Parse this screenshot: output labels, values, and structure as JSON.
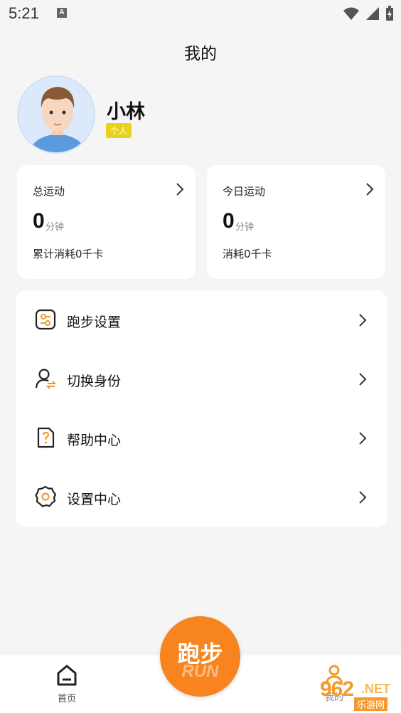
{
  "status_bar": {
    "time": "5:21",
    "notif_letter": "A"
  },
  "header": {
    "title": "我的"
  },
  "user": {
    "name": "小林",
    "badge": "个人"
  },
  "stats": {
    "total": {
      "label": "总运动",
      "value": "0",
      "unit": "分钟",
      "sub": "累计消耗0千卡"
    },
    "today": {
      "label": "今日运动",
      "value": "0",
      "unit": "分钟",
      "sub": "消耗0千卡"
    }
  },
  "menu": {
    "items": [
      {
        "label": "跑步设置",
        "icon": "sliders-icon"
      },
      {
        "label": "切换身份",
        "icon": "user-switch-icon"
      },
      {
        "label": "帮助中心",
        "icon": "help-doc-icon"
      },
      {
        "label": "设置中心",
        "icon": "gear-icon"
      }
    ]
  },
  "tabbar": {
    "home": "首页",
    "run": "跑步",
    "run_en": "RUN",
    "me": "我的"
  },
  "watermark": {
    "num": "962",
    "net": ".NET",
    "cn": "乐游网"
  },
  "colors": {
    "accent": "#f7841e",
    "badge": "#e8d21b",
    "icon_orange": "#f39a2a"
  }
}
